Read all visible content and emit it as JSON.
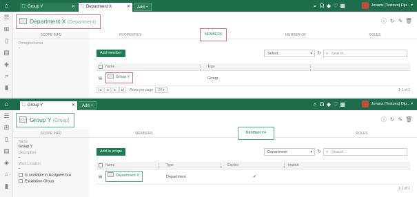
{
  "colors": {
    "brand": "#1e6d4a",
    "accent_green": "#2a8a62",
    "highlight_red": "#d9726a",
    "highlight_green": "#4caf8d"
  },
  "pane1": {
    "tabs": [
      {
        "label": "Group Y",
        "icon": "group-icon"
      },
      {
        "label": "Department X",
        "icon": "group-icon"
      }
    ],
    "add_tab_label": "Add +",
    "user_name": "Jovana (Testova) Dju... ▾",
    "header": {
      "title": "Department X",
      "type": "(Department)"
    },
    "scope_header": "SCOPE INFO",
    "fields": [
      {
        "label": "Principleshemia",
        "value": "-"
      }
    ],
    "tabs_row": [
      "PROPERTIES",
      "MEMBERS",
      "MEMBER OF",
      "ROLES"
    ],
    "action_button": "Add member",
    "filter_value": "Select...",
    "search_placeholder": "Search...",
    "columns": [
      "Name",
      "Type"
    ],
    "rows": [
      {
        "name": "Group Y",
        "type": "Group"
      }
    ],
    "pager": {
      "rows_label": "Rows per page",
      "rows_value": "20",
      "info": "1-1 of 1"
    }
  },
  "pane2": {
    "tabs": [
      {
        "label": "Group Y",
        "icon": "group-icon"
      }
    ],
    "add_tab_label": "Add +",
    "user_name": "Jovana (Testova) Dju... ▾",
    "header": {
      "title": "Group Y",
      "type": "(Group)"
    },
    "scope_header": "SCOPE INFO",
    "fields": [
      {
        "label": "Name",
        "value": "Group Y"
      },
      {
        "label": "Description",
        "value": "-"
      },
      {
        "label": "Work Location",
        "value": "-"
      }
    ],
    "checkboxes": [
      "Is available in Assignee box",
      "Escalation Group"
    ],
    "tabs_row": [
      "MEMBERS",
      "MEMBER OF",
      "ROLES"
    ],
    "action_button": "Add to scope",
    "filter_value": "Department",
    "search_placeholder": "Search...",
    "columns": [
      "Name",
      "Type",
      "Explicit",
      "Implicit"
    ],
    "rows": [
      {
        "name": "Department X",
        "type": "Department",
        "explicit": "✔",
        "implicit": ""
      }
    ],
    "pager": {
      "info": "1-1 of 1"
    }
  }
}
